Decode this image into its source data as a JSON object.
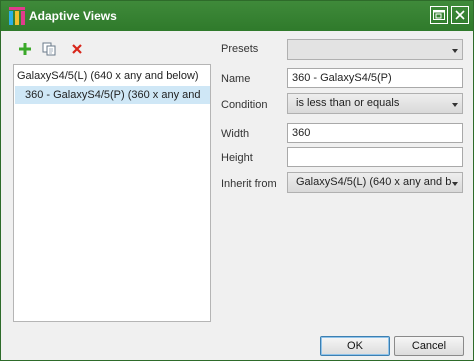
{
  "window": {
    "title": "Adaptive Views"
  },
  "toolbar": {
    "add_icon": "plus-icon",
    "duplicate_icon": "copy-icon",
    "delete_icon": "close-x-icon"
  },
  "views": [
    {
      "label": "GalaxyS4/5(L) (640 x any and below)"
    },
    {
      "label": "360 - GalaxyS4/5(P) (360 x any and"
    }
  ],
  "form": {
    "presets_label": "Presets",
    "presets_value": "",
    "name_label": "Name",
    "name_value": "360 - GalaxyS4/5(P)",
    "condition_label": "Condition",
    "condition_value": "is less than or equals",
    "width_label": "Width",
    "width_value": "360",
    "height_label": "Height",
    "height_value": "",
    "inherit_label": "Inherit from",
    "inherit_value": "GalaxyS4/5(L) (640 x any and b"
  },
  "buttons": {
    "ok": "OK",
    "cancel": "Cancel"
  },
  "colors": {
    "titlebar": "#3f8a3a",
    "selection": "#cfe7f6",
    "add": "#3aa829",
    "delete": "#d8261b"
  }
}
